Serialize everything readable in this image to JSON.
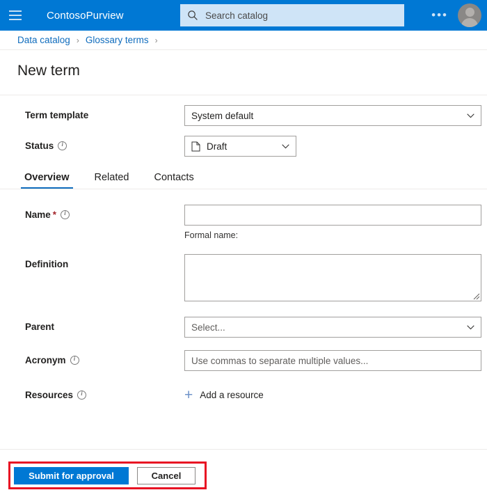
{
  "topbar": {
    "menu_icon": "hamburger-icon",
    "brand": "ContosoPurview",
    "search_placeholder": "Search catalog",
    "search_icon": "search-icon",
    "more_label": "•••",
    "avatar_icon": "user-avatar-icon",
    "bar_color": "#0078d4",
    "search_bg": "#cfe4f7"
  },
  "breadcrumb": {
    "items": [
      {
        "label": "Data catalog"
      },
      {
        "label": "Glossary terms"
      }
    ],
    "separator": "›",
    "link_color": "#0f6cbd"
  },
  "page": {
    "title": "New term"
  },
  "form": {
    "term_template": {
      "label": "Term template",
      "value": "System default"
    },
    "status": {
      "label": "Status",
      "value": "Draft",
      "icon": "document-icon",
      "info_icon": "info-icon"
    },
    "name": {
      "label": "Name",
      "required_marker": "*",
      "info_icon": "info-icon",
      "value": "",
      "placeholder": "",
      "hint": "Formal name:"
    },
    "definition": {
      "label": "Definition",
      "value": ""
    },
    "parent": {
      "label": "Parent",
      "value": "Select..."
    },
    "acronym": {
      "label": "Acronym",
      "info_icon": "info-icon",
      "value": "",
      "placeholder": "Use commas to separate multiple values..."
    },
    "resources": {
      "label": "Resources",
      "info_icon": "info-icon",
      "add_label": "Add a resource",
      "add_icon": "plus-icon"
    }
  },
  "tabs": [
    {
      "label": "Overview",
      "active": true
    },
    {
      "label": "Related",
      "active": false
    },
    {
      "label": "Contacts",
      "active": false
    }
  ],
  "footer": {
    "submit_label": "Submit for approval",
    "cancel_label": "Cancel",
    "primary_color": "#0078d4",
    "highlight_color": "#e81123"
  }
}
